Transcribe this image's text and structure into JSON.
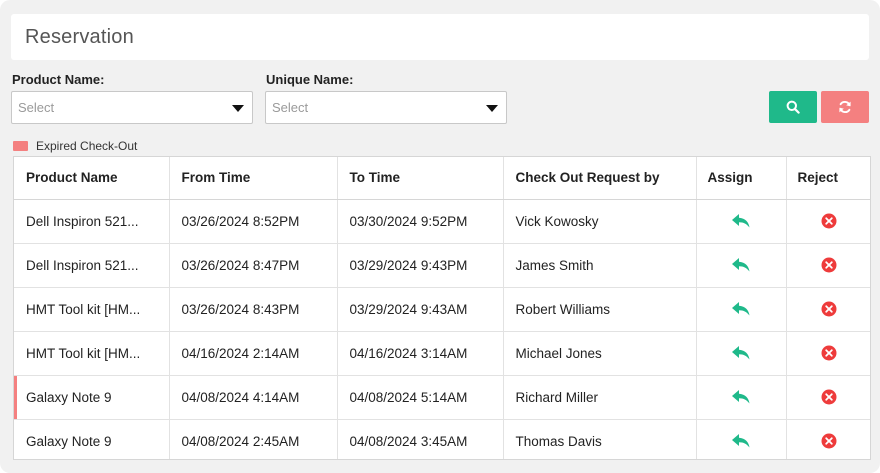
{
  "page": {
    "title": "Reservation"
  },
  "filters": {
    "product_label": "Product Name:",
    "product_placeholder": "Select",
    "unique_label": "Unique Name:",
    "unique_placeholder": "Select"
  },
  "legend": {
    "label": "Expired Check-Out",
    "color": "#f48080"
  },
  "colors": {
    "accent_green": "#1fb98a",
    "accent_red": "#f48080",
    "reject_red": "#ee3b3b"
  },
  "table": {
    "headers": [
      "Product Name",
      "From Time",
      "To Time",
      "Check Out Request by",
      "Assign",
      "Reject"
    ],
    "rows": [
      {
        "product": "Dell Inspiron 521...",
        "from": "03/26/2024 8:52PM",
        "to": "03/30/2024 9:52PM",
        "requested_by": "Vick Kowosky",
        "expired": false
      },
      {
        "product": "Dell Inspiron 521...",
        "from": "03/26/2024 8:47PM",
        "to": "03/29/2024 9:43PM",
        "requested_by": "James Smith",
        "expired": false
      },
      {
        "product": "HMT Tool kit [HM...",
        "from": "03/26/2024 8:43PM",
        "to": "03/29/2024 9:43AM",
        "requested_by": "Robert Williams",
        "expired": false
      },
      {
        "product": "HMT Tool kit [HM...",
        "from": "04/16/2024 2:14AM",
        "to": "04/16/2024 3:14AM",
        "requested_by": "Michael Jones",
        "expired": false
      },
      {
        "product": "Galaxy Note 9",
        "from": "04/08/2024 4:14AM",
        "to": "04/08/2024 5:14AM",
        "requested_by": "Richard Miller",
        "expired": true
      },
      {
        "product": "Galaxy Note 9",
        "from": "04/08/2024 2:45AM",
        "to": "04/08/2024 3:45AM",
        "requested_by": "Thomas Davis",
        "expired": false
      }
    ]
  },
  "icons": {
    "search": "search-icon",
    "reset": "refresh-icon",
    "assign": "reply-arrow-icon",
    "reject": "close-circle-icon"
  }
}
